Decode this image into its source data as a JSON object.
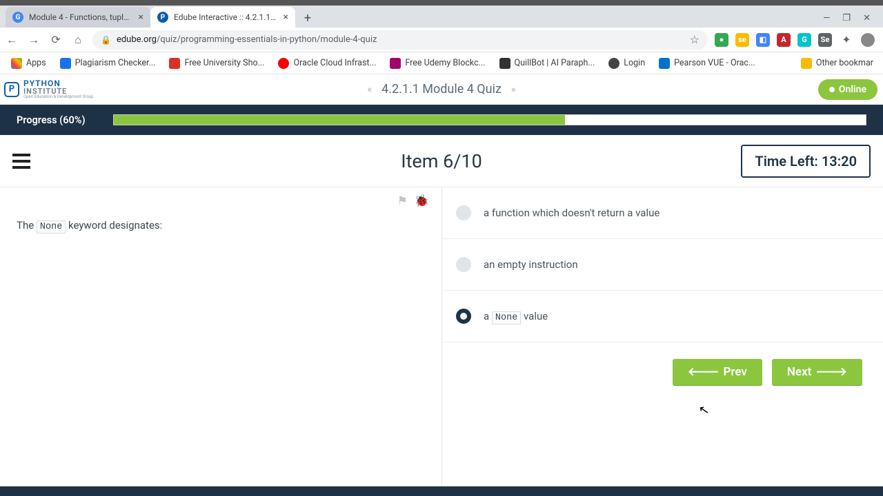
{
  "browser": {
    "tabs": [
      {
        "title": "Module 4 - Functions, tuples, dic",
        "active": false
      },
      {
        "title": "Edube Interactive :: 4.2.1.1 Modu",
        "active": true
      }
    ],
    "url_domain": "edube.org",
    "url_path": "/quiz/programming-essentials-in-python/module-4-quiz",
    "bookmarks": [
      "Apps",
      "Plagiarism Checker...",
      "Free University Sho...",
      "Oracle Cloud Infrast...",
      "Free Udemy Blockc...",
      "QuillBot | AI Paraph...",
      "Login",
      "Pearson VUE - Orac..."
    ],
    "other_bookmarks": "Other bookmar"
  },
  "header": {
    "logo_line1": "PYTHON",
    "logo_line2": "INSTITUTE",
    "logo_line3": "Open Education & Development Group",
    "title": "4.2.1.1 Module 4 Quiz",
    "online": "Online"
  },
  "progress": {
    "label": "Progress (60%)",
    "percent": 60
  },
  "quiz": {
    "item_label": "Item 6/10",
    "timer": "Time Left: 13:20",
    "question_pre": "The ",
    "question_code": "None",
    "question_post": " keyword designates:",
    "options": [
      {
        "text": "a function which doesn't return a value",
        "selected": false,
        "has_code": false
      },
      {
        "text": "an empty instruction",
        "selected": false,
        "has_code": false
      },
      {
        "pre": "a ",
        "code": "None",
        "post": " value",
        "selected": true,
        "has_code": true
      }
    ],
    "prev": "Prev",
    "next": "Next"
  }
}
